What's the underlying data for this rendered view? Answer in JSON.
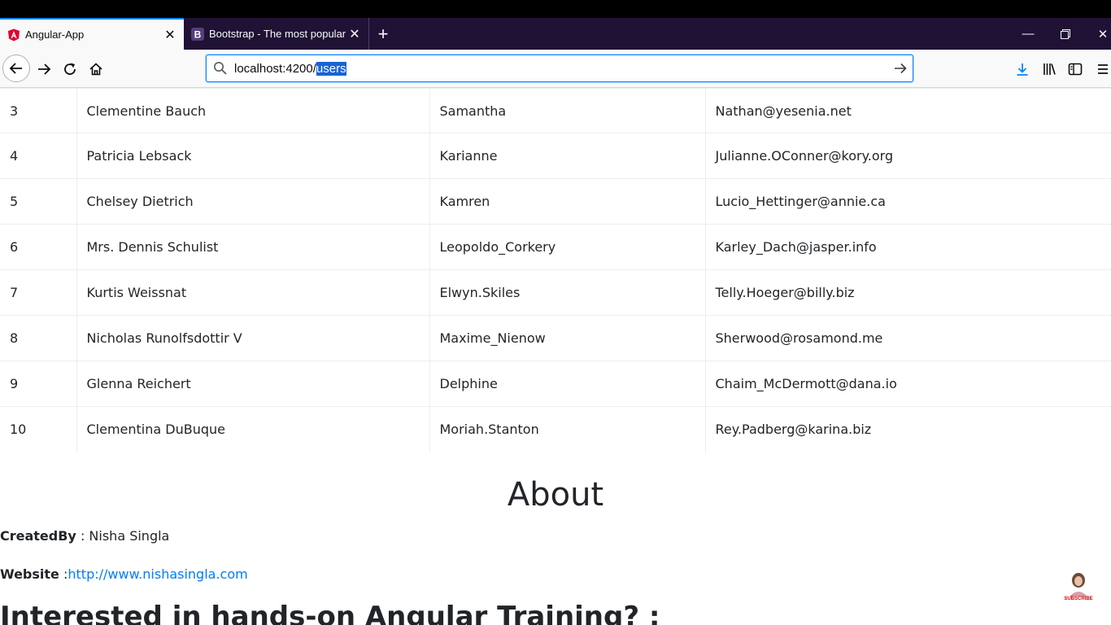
{
  "browser": {
    "tabs": [
      {
        "title": "Angular-App",
        "favicon": "angular-icon",
        "active": true
      },
      {
        "title": "Bootstrap - The most popular H",
        "favicon": "bootstrap-icon",
        "active": false
      }
    ],
    "url": {
      "host_path": "localhost:4200/",
      "selected": "users"
    }
  },
  "table": {
    "rows": [
      {
        "id": "3",
        "name": "Clementine Bauch",
        "username": "Samantha",
        "email": "Nathan@yesenia.net"
      },
      {
        "id": "4",
        "name": "Patricia Lebsack",
        "username": "Karianne",
        "email": "Julianne.OConner@kory.org"
      },
      {
        "id": "5",
        "name": "Chelsey Dietrich",
        "username": "Kamren",
        "email": "Lucio_Hettinger@annie.ca"
      },
      {
        "id": "6",
        "name": "Mrs. Dennis Schulist",
        "username": "Leopoldo_Corkery",
        "email": "Karley_Dach@jasper.info"
      },
      {
        "id": "7",
        "name": "Kurtis Weissnat",
        "username": "Elwyn.Skiles",
        "email": "Telly.Hoeger@billy.biz"
      },
      {
        "id": "8",
        "name": "Nicholas Runolfsdottir V",
        "username": "Maxime_Nienow",
        "email": "Sherwood@rosamond.me"
      },
      {
        "id": "9",
        "name": "Glenna Reichert",
        "username": "Delphine",
        "email": "Chaim_McDermott@dana.io"
      },
      {
        "id": "10",
        "name": "Clementina DuBuque",
        "username": "Moriah.Stanton",
        "email": "Rey.Padberg@karina.biz"
      }
    ]
  },
  "about": {
    "heading": "About",
    "created_by_label": "CreatedBy",
    "created_by_sep": " : ",
    "created_by_value": "Nisha Singla",
    "website_label": "Website",
    "website_sep": " :",
    "website_link": "http://www.nishasingla.com",
    "training_heading": "Interested in hands-on Angular Training? :"
  },
  "overlay": {
    "subscribe_text": "SUBSCRIBE"
  },
  "colors": {
    "accent": "#0a84ff",
    "link": "#007bff",
    "tabstrip": "#1f1235"
  }
}
